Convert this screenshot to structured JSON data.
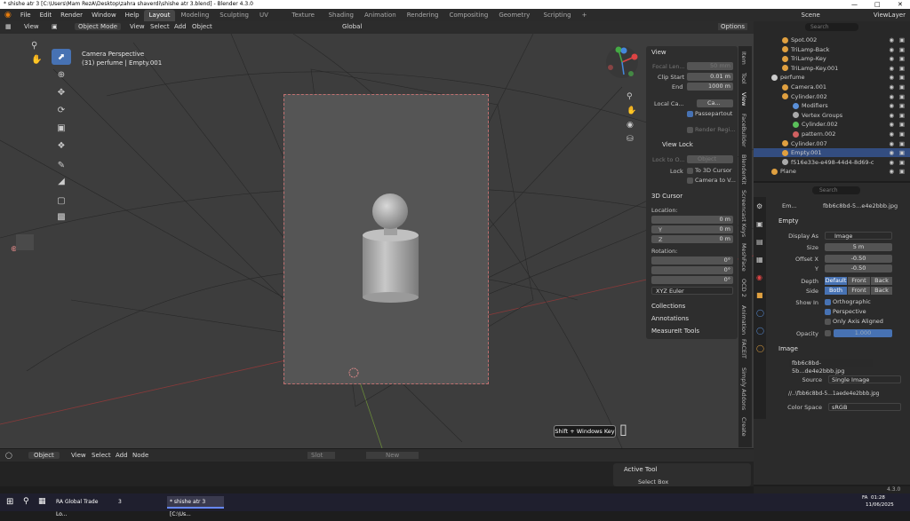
{
  "window": {
    "title": "* shishe atr 3 [C:\\Users\\Mam RezA\\Desktop\\zahra shaverdi\\shishe atr 3.blend] - Blender 4.3.0"
  },
  "menu": [
    "File",
    "Edit",
    "Render",
    "Window",
    "Help"
  ],
  "workspaces": [
    "Layout",
    "Modeling",
    "Sculpting",
    "UV Editing",
    "Texture Paint",
    "Shading",
    "Animation",
    "Rendering",
    "Compositing",
    "Geometry Nodes",
    "Scripting"
  ],
  "scene": {
    "label": "Scene",
    "viewlayer": "ViewLayer"
  },
  "header3d": {
    "view": "View",
    "mode": "Object Mode",
    "menus": [
      "View",
      "Select",
      "Add",
      "Object"
    ],
    "orientation": "Global",
    "options": "Options",
    "search_placeholder": "Search"
  },
  "viewport": {
    "camera_label": "Camera Perspective",
    "object_label": "(31) perfume | Empty.001"
  },
  "npanel": {
    "view_header": "View",
    "focal_label": "Focal Len...",
    "focal_value": "50 mm",
    "clip_start_label": "Clip Start",
    "clip_start_value": "0.01 m",
    "end_label": "End",
    "end_value": "1000 m",
    "local_camera_label": "Local Ca...",
    "local_camera_value": "Ca...",
    "passepartout": "Passepartout",
    "render_region": "Render Regi...",
    "view_lock_header": "View Lock",
    "lock_to_object_label": "Lock to O...",
    "lock_to_object_value": "Object",
    "lock_label": "Lock",
    "to_3d_cursor": "To 3D Cursor",
    "camera_to_view": "Camera to V...",
    "cursor_header": "3D Cursor",
    "location_label": "Location:",
    "x_label": "X",
    "y_label": "Y",
    "z_label": "Z",
    "loc_x": "0 m",
    "loc_y": "0 m",
    "loc_z": "0 m",
    "rotation_label": "Rotation:",
    "rot_x": "0°",
    "rot_y": "0°",
    "rot_z": "0°",
    "rot_mode": "XYZ Euler",
    "collections": "Collections",
    "annotations": "Annotations",
    "measureit": "MeasureIt Tools"
  },
  "vtabs": [
    "Item",
    "Tool",
    "View",
    "FaceBuilder",
    "BlenderKit",
    "Screencast Keys",
    "MeshFace",
    "OCD 2",
    "Animation",
    "FACEIT",
    "Simply Addons",
    "Create"
  ],
  "outliner": {
    "search_placeholder": "Search",
    "rows": [
      {
        "name": "Spot.002",
        "color": "#e0a040"
      },
      {
        "name": "TriLamp-Back",
        "color": "#e0a040"
      },
      {
        "name": "TriLamp-Key",
        "color": "#e0a040"
      },
      {
        "name": "TriLamp-Key.001",
        "color": "#e0a040"
      },
      {
        "name": "perfume",
        "color": "#cccccc"
      },
      {
        "name": "Camera.001",
        "color": "#e0a040"
      },
      {
        "name": "Cylinder.002",
        "color": "#e0a040"
      },
      {
        "name": "Modifiers",
        "color": "#5a8fd8"
      },
      {
        "name": "Vertex Groups",
        "color": "#aaaaaa"
      },
      {
        "name": "Cylinder.002",
        "color": "#5ac05a"
      },
      {
        "name": "pattern.002",
        "color": "#d06060"
      },
      {
        "name": "Cylinder.007",
        "color": "#e0a040"
      },
      {
        "name": "Empty.001",
        "color": "#e0a040"
      },
      {
        "name": "f516e33e-e498-44d4-8d69-c",
        "color": "#aaaaaa"
      },
      {
        "name": "Plane",
        "color": "#e0a040"
      }
    ]
  },
  "properties": {
    "search_placeholder": "Search",
    "object_name": "Em...",
    "image_name": "fbb6c8bd-5...e4e2bbb.jpg",
    "empty_header": "Empty",
    "display_as_label": "Display As",
    "display_as_value": "Image",
    "size_label": "Size",
    "size_value": "5 m",
    "offset_x_label": "Offset X",
    "offset_x_value": "-0.50",
    "offset_y_label": "Y",
    "offset_y_value": "-0.50",
    "depth_label": "Depth",
    "depth_options": [
      "Default",
      "Front",
      "Back"
    ],
    "side_label": "Side",
    "side_options": [
      "Both",
      "Front",
      "Back"
    ],
    "show_in_label": "Show In",
    "orthographic": "Orthographic",
    "perspective": "Perspective",
    "only_axis_aligned": "Only Axis Aligned",
    "opacity_label": "Opacity",
    "opacity_value": "1.000",
    "image_header": "Image",
    "image_field": "fbb6c8bd-5b...de4e2bbb.jpg",
    "source_label": "Source",
    "source_value": "Single Image",
    "filepath": "//..\\fbb6c8bd-5...1aede4e2bbb.jpg",
    "color_space_label": "Color Space",
    "color_space_value": "sRGB"
  },
  "timeline": {
    "mode": "Object",
    "menus": [
      "View",
      "Select",
      "Add",
      "Node"
    ],
    "slot": "Slot",
    "new": "New"
  },
  "active_tool": {
    "header": "Active Tool",
    "tool": "Select Box"
  },
  "tooltip": "Shift + Windows Key",
  "version": "4.3.0",
  "taskbar": {
    "items": [
      "RA Global Trade Lo...",
      "3",
      "* shishe atr 3 [C:\\Us..."
    ],
    "time": "01:28",
    "date": "11/06/2025",
    "lang": "FA"
  }
}
